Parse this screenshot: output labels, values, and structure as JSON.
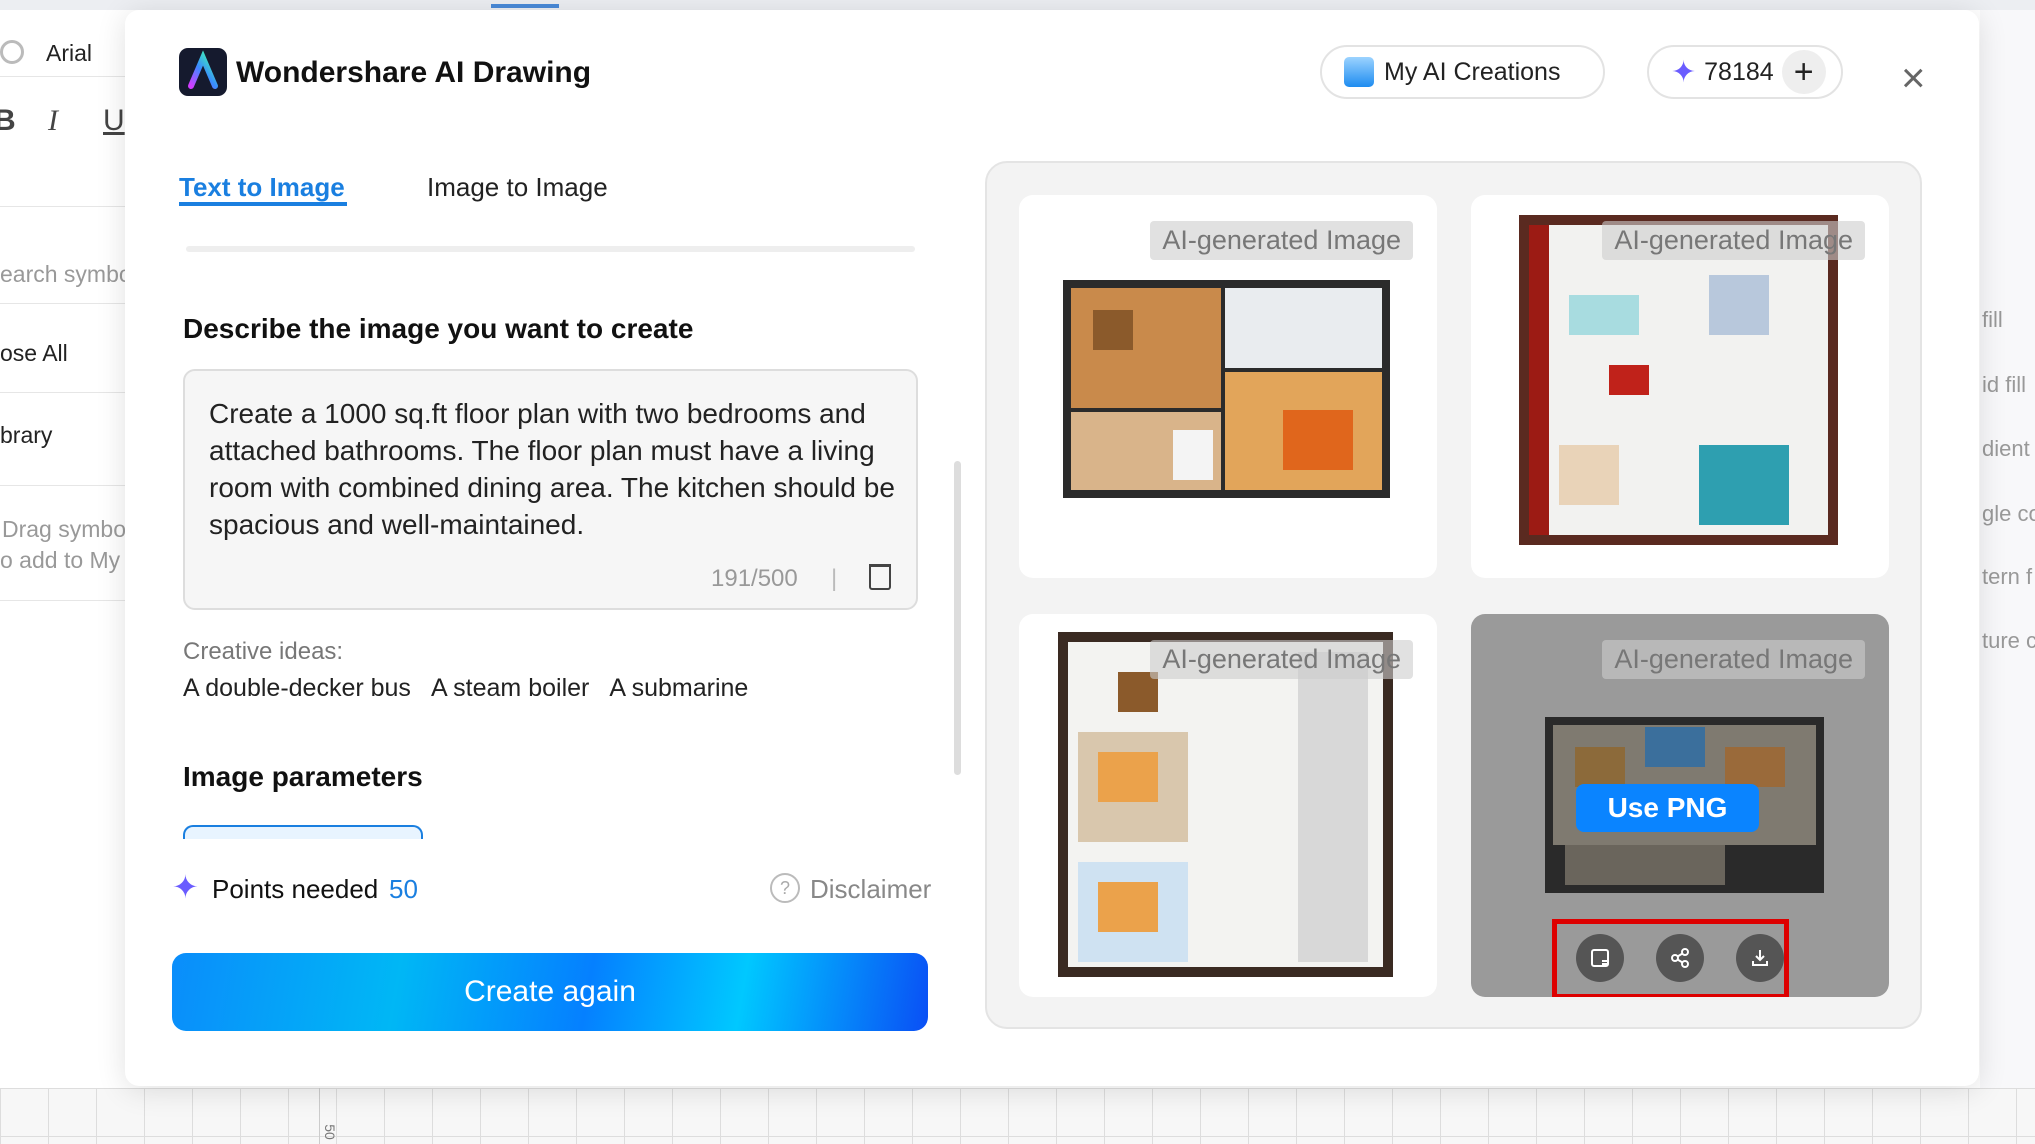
{
  "background": {
    "left_panel": {
      "font": "Arial",
      "format": [
        "B",
        "I",
        "U"
      ],
      "search_placeholder": "earch symbo",
      "close_all": "ose All",
      "library": "brary",
      "drag_hint": [
        "Drag symbo",
        "o add to My"
      ]
    },
    "right_panel": {
      "items": [
        "fill",
        "id fill",
        "dient",
        "gle co",
        "tern f",
        "ture c"
      ]
    },
    "ruler_label": "50"
  },
  "header": {
    "app_title": "Wondershare AI Drawing",
    "my_creations": "My AI Creations",
    "points": "78184",
    "add_label": "+",
    "close_label": "×"
  },
  "tabs": [
    {
      "label": "Text to Image",
      "active": true
    },
    {
      "label": "Image to Image",
      "active": false
    }
  ],
  "prompt": {
    "heading": "Describe the image you want to create",
    "text": "Create a 1000 sq.ft floor plan with two bedrooms and attached bathrooms. The floor plan must have a living room with combined dining area. The kitchen should be spacious and well-maintained.",
    "count": "191/500",
    "separator": "|"
  },
  "creative": {
    "label": "Creative ideas:",
    "ideas": [
      "A double-decker bus",
      "A steam boiler",
      "A submarine"
    ]
  },
  "params": {
    "heading": "Image parameters"
  },
  "footer": {
    "points_label": "Points needed",
    "points_value": "50",
    "disclaimer": "Disclaimer",
    "create_button": "Create again"
  },
  "gallery": {
    "label": "AI-generated Image",
    "use_png": "Use PNG",
    "actions": [
      "edit-image-icon",
      "share-icon",
      "download-icon"
    ]
  },
  "colors": {
    "accent": "#1a7fe0",
    "highlight_box": "#dd0000",
    "points_value": "#1a7fe0"
  }
}
